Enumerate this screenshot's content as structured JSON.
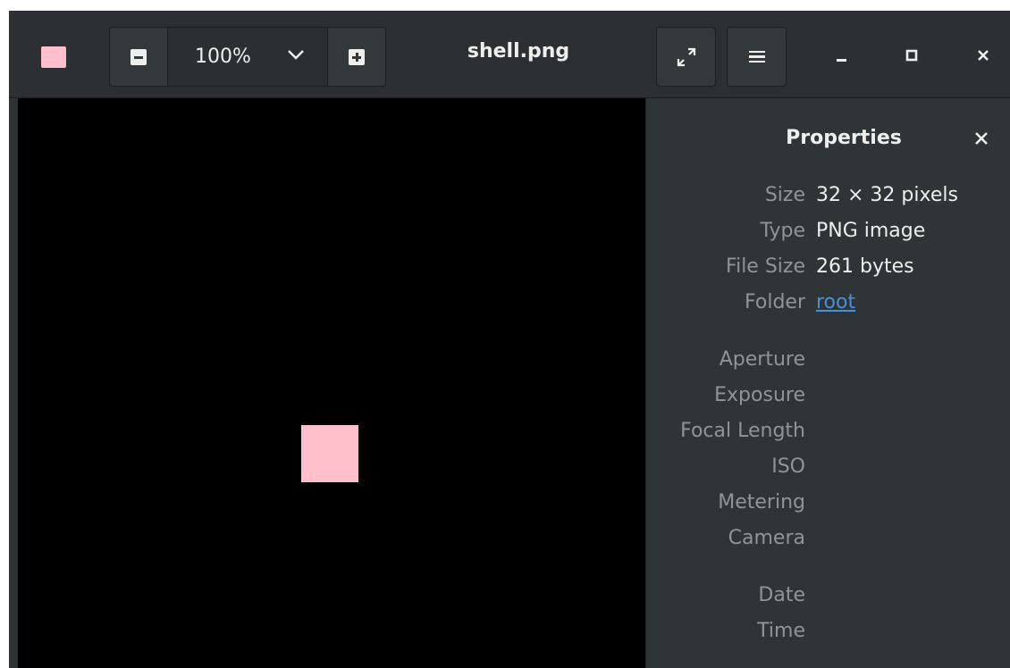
{
  "window": {
    "title": "shell.png",
    "thumbnail_color": "#ffc0cb"
  },
  "toolbar": {
    "zoom_value": "100%",
    "zoom_out_icon": "zoom-out-icon",
    "zoom_in_icon": "zoom-in-icon",
    "zoom_menu_icon": "chevron-down-icon",
    "fullscreen_icon": "fullscreen-icon",
    "menu_icon": "hamburger-menu-icon",
    "minimize_icon": "minimize-icon",
    "maximize_icon": "maximize-icon",
    "close_icon": "close-icon"
  },
  "image": {
    "background": "#000000",
    "pixel_color": "#ffc0cb"
  },
  "properties": {
    "title": "Properties",
    "close_icon": "close-icon",
    "rows": [
      {
        "label": "Size",
        "value": "32 × 32 pixels"
      },
      {
        "label": "Type",
        "value": "PNG image"
      },
      {
        "label": "File Size",
        "value": "261 bytes"
      },
      {
        "label": "Folder",
        "value": "root"
      }
    ],
    "exif_labels": [
      "Aperture",
      "Exposure",
      "Focal Length",
      "ISO",
      "Metering",
      "Camera"
    ],
    "date_labels": [
      "Date",
      "Time"
    ]
  },
  "colors": {
    "headerbar": "#2d3032",
    "sidebar": "#2f3436",
    "text": "#eeeeec",
    "dim_text": "#8f9596",
    "link": "#4a90d9"
  }
}
